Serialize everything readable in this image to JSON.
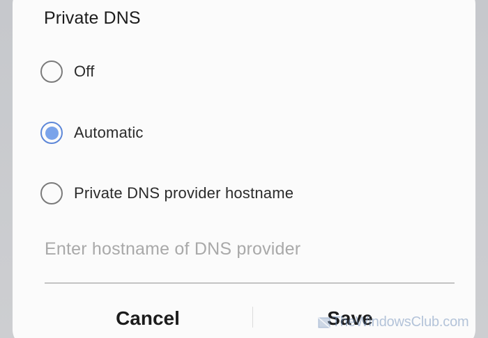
{
  "dialog": {
    "title": "Private DNS",
    "options": [
      {
        "label": "Off",
        "selected": false
      },
      {
        "label": "Automatic",
        "selected": true
      },
      {
        "label": "Private DNS provider hostname",
        "selected": false
      }
    ],
    "hostname_input": {
      "value": "",
      "placeholder": "Enter hostname of DNS provider"
    },
    "buttons": {
      "cancel_label": "Cancel",
      "save_label": "Save"
    }
  },
  "watermark": {
    "text": "TheWindowsClub.com"
  },
  "colors": {
    "accent": "#7aa3ea",
    "radio_border_selected": "#5d87d8",
    "radio_border": "#7a7a7a",
    "dialog_background": "#fbfbfb",
    "page_background": "#c9cacc",
    "placeholder_text": "#a9a9a9"
  }
}
